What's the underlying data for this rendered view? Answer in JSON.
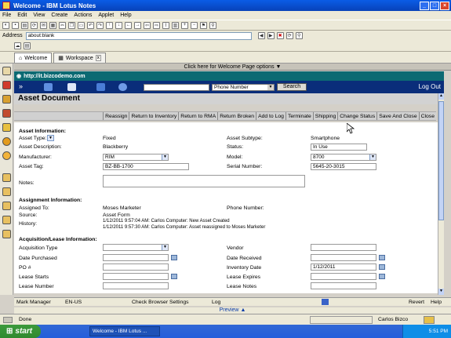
{
  "window": {
    "title": "Welcome - IBM Lotus Notes"
  },
  "menu": [
    "File",
    "Edit",
    "View",
    "Create",
    "Actions",
    "Applet",
    "Help"
  ],
  "address": {
    "label": "Address",
    "value": "about:blank"
  },
  "tabs": [
    {
      "label": "Welcome"
    },
    {
      "label": "Workspace"
    }
  ],
  "welcome_bar": "Click here for Welcome Page options",
  "site_url": "http://it.bizcodemo.com",
  "search": {
    "select": "Phone Number",
    "button": "Search",
    "logout": "Log Out"
  },
  "document": {
    "title": "Asset Document"
  },
  "actions": [
    "Reassign",
    "Return to Inventory",
    "Return to RMA",
    "Return Broken",
    "Add to Log",
    "Terminate",
    "Shipping",
    "Change Status",
    "Save And Close",
    "Close"
  ],
  "asset": {
    "section": "Asset Information:",
    "type_label": "Asset Type:",
    "type_value": "Fixed",
    "subtype_label": "Asset Subtype:",
    "subtype_value": "Smartphone",
    "desc_label": "Asset Description:",
    "desc_value": "Blackberry",
    "status_label": "Status:",
    "status_value": "In Use",
    "manufacturer_label": "Manufacturer:",
    "manufacturer_value": "RIM",
    "model_label": "Model:",
    "model_value": "8700",
    "tag_label": "Asset Tag:",
    "tag_value": "BZ-BB-1700",
    "serial_label": "Serial Number:",
    "serial_value": "5645-20-3015",
    "notes_label": "Notes:"
  },
  "assignment": {
    "section": "Assignment Information:",
    "assigned_label": "Assigned To:",
    "assigned_value": "Moses Marketer",
    "phone_label": "Phone Number:",
    "source_label": "Source:",
    "source_value": "Asset Form",
    "history_label": "History:",
    "history": [
      "1/12/2011 9:57:04 AM: Carlos Computer: New Asset Created",
      "1/12/2011 9:57:30 AM: Carlos Computer: Asset reassigned to Moses Marketer"
    ]
  },
  "acquisition": {
    "section": "Acquisition/Lease Information:",
    "acq_type_label": "Acquisition Type",
    "vendor_label": "Vendor",
    "purchased_label": "Date Purchased",
    "received_label": "Date Received",
    "po_label": "PO #",
    "inventory_label": "Inventory Date",
    "inventory_value": "1/12/2011",
    "lease_starts_label": "Lease Starts",
    "lease_expires_label": "Lease Expires",
    "lease_number_label": "Lease Number",
    "lease_notes_label": "Lease Notes"
  },
  "statusbar": {
    "items": [
      "Mark Manager",
      "EN-US",
      "Check Browser Settings",
      "Log"
    ],
    "revert": "Revert",
    "help": "Help"
  },
  "preview": "Preview",
  "notes_status": {
    "done": "Done",
    "user": "Carlos Bizco"
  },
  "taskbar": {
    "start": "start",
    "item": "Welcome - IBM Lotus ...",
    "clock": "5:51 PM"
  }
}
